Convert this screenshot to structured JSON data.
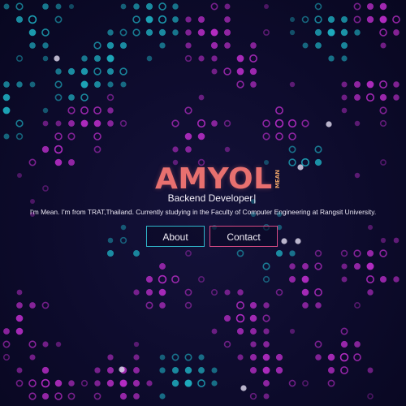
{
  "hero": {
    "logo_text": "AMYOL",
    "logo_badge": "MEAN",
    "role": "Backend Developer",
    "caret": "|",
    "bio": "I'm Mean. I'm from TRAT,Thailand. Currently studying in the Faculty of Computer Engineering at Rangsit University."
  },
  "buttons": {
    "about": "About",
    "contact": "Contact"
  },
  "colors": {
    "background": "#0b0a26",
    "logo": "#e8706f",
    "accent_cyan": "#2fb5c9",
    "accent_pink": "#d64a83",
    "dot_magenta": "#c22fd0",
    "dot_cyan": "#1fb6c8"
  }
}
